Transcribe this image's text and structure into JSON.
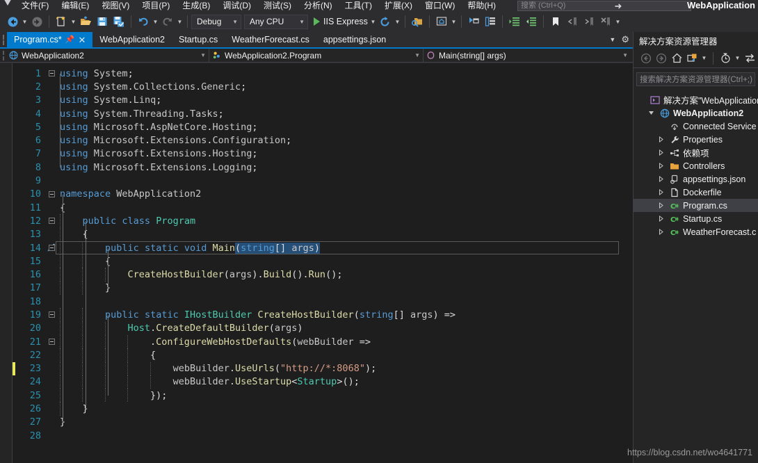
{
  "window": {
    "title": "WebApplication",
    "logo_icon": "visual-studio-logo"
  },
  "menu": {
    "items": [
      {
        "label": "文件(F)"
      },
      {
        "label": "编辑(E)"
      },
      {
        "label": "视图(V)"
      },
      {
        "label": "项目(P)"
      },
      {
        "label": "生成(B)"
      },
      {
        "label": "调试(D)"
      },
      {
        "label": "测试(S)"
      },
      {
        "label": "分析(N)"
      },
      {
        "label": "工具(T)"
      },
      {
        "label": "扩展(X)"
      },
      {
        "label": "窗口(W)"
      },
      {
        "label": "帮助(H)"
      }
    ],
    "search_placeholder": "搜索 (Ctrl+Q)"
  },
  "toolbar": {
    "back_icon": "navigate-back-icon",
    "forward_icon": "navigate-forward-icon",
    "new_item_icon": "new-item-icon",
    "open_file_icon": "open-file-icon",
    "save_icon": "save-icon",
    "save_all_icon": "save-all-icon",
    "undo_icon": "undo-icon",
    "redo_icon": "redo-icon",
    "configuration": "Debug",
    "platform": "Any CPU",
    "run_target": "IIS Express",
    "run_icon": "play-icon",
    "refresh_icon": "refresh-icon",
    "find_in_folder_icon": "find-in-folder-icon",
    "preview_icon": "preview-selected-items-icon",
    "properties_icon": "properties-window-icon",
    "object_browser_icon": "object-browser-icon",
    "indent_icon": "increase-indent-icon",
    "outdent_icon": "decrease-indent-icon",
    "bookmark_icon": "bookmark-icon",
    "prev_bookmark_icon": "previous-bookmark-icon",
    "next_bookmark_icon": "next-bookmark-icon",
    "clear_bookmark_icon": "clear-bookmarks-icon",
    "overflow_icon": "toolbar-overflow-icon"
  },
  "tabs": {
    "items": [
      {
        "label": "Program.cs*",
        "active": true,
        "dirty": true
      },
      {
        "label": "WebApplication2",
        "active": false
      },
      {
        "label": "Startup.cs",
        "active": false
      },
      {
        "label": "WeatherForecast.cs",
        "active": false
      },
      {
        "label": "appsettings.json",
        "active": false
      }
    ],
    "pin_icon": "pin-icon",
    "close_icon": "close-icon",
    "dropdown_icon": "tab-list-dropdown-icon",
    "settings_icon": "gear-icon"
  },
  "navbar": {
    "project": "WebApplication2",
    "project_icon": "web-project-icon",
    "type": "WebApplication2.Program",
    "type_icon": "class-icon",
    "member": "Main(string[] args)",
    "member_icon": "method-icon",
    "caret_icon": "chevron-down-icon"
  },
  "editor": {
    "quick_actions_icon": "quick-actions-screwdriver-icon",
    "quick_actions_line": 14,
    "changed_lines": [
      23
    ],
    "current_line": 14,
    "lines": [
      {
        "n": 1,
        "fold": "minus",
        "tokens": [
          {
            "t": "using ",
            "c": "k"
          },
          {
            "t": "System",
            "c": "ns"
          },
          {
            "t": ";",
            "c": "pn"
          }
        ]
      },
      {
        "n": 2,
        "tokens": [
          {
            "t": "using ",
            "c": "k"
          },
          {
            "t": "System",
            "c": "ns"
          },
          {
            "t": ".",
            "c": "pn"
          },
          {
            "t": "Collections",
            "c": "ns"
          },
          {
            "t": ".",
            "c": "pn"
          },
          {
            "t": "Generic",
            "c": "ns"
          },
          {
            "t": ";",
            "c": "pn"
          }
        ]
      },
      {
        "n": 3,
        "tokens": [
          {
            "t": "using ",
            "c": "k"
          },
          {
            "t": "System",
            "c": "ns"
          },
          {
            "t": ".",
            "c": "pn"
          },
          {
            "t": "Linq",
            "c": "ns"
          },
          {
            "t": ";",
            "c": "pn"
          }
        ]
      },
      {
        "n": 4,
        "tokens": [
          {
            "t": "using ",
            "c": "k"
          },
          {
            "t": "System",
            "c": "ns"
          },
          {
            "t": ".",
            "c": "pn"
          },
          {
            "t": "Threading",
            "c": "ns"
          },
          {
            "t": ".",
            "c": "pn"
          },
          {
            "t": "Tasks",
            "c": "ns"
          },
          {
            "t": ";",
            "c": "pn"
          }
        ]
      },
      {
        "n": 5,
        "tokens": [
          {
            "t": "using ",
            "c": "k"
          },
          {
            "t": "Microsoft",
            "c": "ns"
          },
          {
            "t": ".",
            "c": "pn"
          },
          {
            "t": "AspNetCore",
            "c": "ns"
          },
          {
            "t": ".",
            "c": "pn"
          },
          {
            "t": "Hosting",
            "c": "ns"
          },
          {
            "t": ";",
            "c": "pn"
          }
        ]
      },
      {
        "n": 6,
        "tokens": [
          {
            "t": "using ",
            "c": "k"
          },
          {
            "t": "Microsoft",
            "c": "ns"
          },
          {
            "t": ".",
            "c": "pn"
          },
          {
            "t": "Extensions",
            "c": "ns"
          },
          {
            "t": ".",
            "c": "pn"
          },
          {
            "t": "Configuration",
            "c": "ns"
          },
          {
            "t": ";",
            "c": "pn"
          }
        ]
      },
      {
        "n": 7,
        "tokens": [
          {
            "t": "using ",
            "c": "k"
          },
          {
            "t": "Microsoft",
            "c": "ns"
          },
          {
            "t": ".",
            "c": "pn"
          },
          {
            "t": "Extensions",
            "c": "ns"
          },
          {
            "t": ".",
            "c": "pn"
          },
          {
            "t": "Hosting",
            "c": "ns"
          },
          {
            "t": ";",
            "c": "pn"
          }
        ]
      },
      {
        "n": 8,
        "tokens": [
          {
            "t": "using ",
            "c": "k"
          },
          {
            "t": "Microsoft",
            "c": "ns"
          },
          {
            "t": ".",
            "c": "pn"
          },
          {
            "t": "Extensions",
            "c": "ns"
          },
          {
            "t": ".",
            "c": "pn"
          },
          {
            "t": "Logging",
            "c": "ns"
          },
          {
            "t": ";",
            "c": "pn"
          }
        ]
      },
      {
        "n": 9,
        "tokens": []
      },
      {
        "n": 10,
        "fold": "minus",
        "tokens": [
          {
            "t": "namespace ",
            "c": "k"
          },
          {
            "t": "WebApplication2",
            "c": "ns"
          }
        ]
      },
      {
        "n": 11,
        "tokens": [
          {
            "t": "{",
            "c": "pn"
          }
        ]
      },
      {
        "n": 12,
        "fold": "minus",
        "indent": 1,
        "tokens": [
          {
            "t": "    ",
            "c": "pn"
          },
          {
            "t": "public ",
            "c": "k"
          },
          {
            "t": "class ",
            "c": "k"
          },
          {
            "t": "Program",
            "c": "ty"
          }
        ]
      },
      {
        "n": 13,
        "indent": 1,
        "tokens": [
          {
            "t": "    {",
            "c": "pn"
          }
        ]
      },
      {
        "n": 14,
        "fold": "minus",
        "indent": 2,
        "tokens": [
          {
            "t": "        ",
            "c": "pn"
          },
          {
            "t": "public ",
            "c": "k"
          },
          {
            "t": "static ",
            "c": "k"
          },
          {
            "t": "void ",
            "c": "k"
          },
          {
            "t": "Main",
            "c": "fn"
          },
          {
            "t": "(",
            "c": "pn sel"
          },
          {
            "t": "string",
            "c": "k sel"
          },
          {
            "t": "[] ",
            "c": "pn sel"
          },
          {
            "t": "args",
            "c": "ns sel"
          },
          {
            "t": ")",
            "c": "pn sel"
          }
        ]
      },
      {
        "n": 15,
        "indent": 2,
        "tokens": [
          {
            "t": "        {",
            "c": "pn"
          }
        ]
      },
      {
        "n": 16,
        "indent": 3,
        "tokens": [
          {
            "t": "            ",
            "c": "pn"
          },
          {
            "t": "CreateHostBuilder",
            "c": "fn"
          },
          {
            "t": "(",
            "c": "pn"
          },
          {
            "t": "args",
            "c": "ns"
          },
          {
            "t": ").",
            "c": "pn"
          },
          {
            "t": "Build",
            "c": "fn"
          },
          {
            "t": "().",
            "c": "pn"
          },
          {
            "t": "Run",
            "c": "fn"
          },
          {
            "t": "();",
            "c": "pn"
          }
        ]
      },
      {
        "n": 17,
        "indent": 2,
        "tokens": [
          {
            "t": "        }",
            "c": "pn"
          }
        ]
      },
      {
        "n": 18,
        "tokens": []
      },
      {
        "n": 19,
        "fold": "minus",
        "indent": 2,
        "tokens": [
          {
            "t": "        ",
            "c": "pn"
          },
          {
            "t": "public ",
            "c": "k"
          },
          {
            "t": "static ",
            "c": "k"
          },
          {
            "t": "IHostBuilder ",
            "c": "ty"
          },
          {
            "t": "CreateHostBuilder",
            "c": "fn"
          },
          {
            "t": "(",
            "c": "pn"
          },
          {
            "t": "string",
            "c": "k"
          },
          {
            "t": "[] ",
            "c": "pn"
          },
          {
            "t": "args",
            "c": "ns"
          },
          {
            "t": ") =>",
            "c": "pn"
          }
        ]
      },
      {
        "n": 20,
        "indent": 3,
        "tokens": [
          {
            "t": "            ",
            "c": "pn"
          },
          {
            "t": "Host",
            "c": "ty"
          },
          {
            "t": ".",
            "c": "pn"
          },
          {
            "t": "CreateDefaultBuilder",
            "c": "fn"
          },
          {
            "t": "(",
            "c": "pn"
          },
          {
            "t": "args",
            "c": "ns"
          },
          {
            "t": ")",
            "c": "pn"
          }
        ]
      },
      {
        "n": 21,
        "fold": "minus",
        "indent": 4,
        "tokens": [
          {
            "t": "                .",
            "c": "pn"
          },
          {
            "t": "ConfigureWebHostDefaults",
            "c": "fn"
          },
          {
            "t": "(",
            "c": "pn"
          },
          {
            "t": "webBuilder",
            "c": "ns"
          },
          {
            "t": " =>",
            "c": "pn"
          }
        ]
      },
      {
        "n": 22,
        "indent": 4,
        "tokens": [
          {
            "t": "                {",
            "c": "pn"
          }
        ]
      },
      {
        "n": 23,
        "indent": 5,
        "tokens": [
          {
            "t": "                    ",
            "c": "pn"
          },
          {
            "t": "webBuilder",
            "c": "ns"
          },
          {
            "t": ".",
            "c": "pn"
          },
          {
            "t": "UseUrls",
            "c": "fn"
          },
          {
            "t": "(",
            "c": "pn"
          },
          {
            "t": "\"http://*:8068\"",
            "c": "st"
          },
          {
            "t": ");",
            "c": "pn"
          }
        ]
      },
      {
        "n": 24,
        "indent": 5,
        "tokens": [
          {
            "t": "                    ",
            "c": "pn"
          },
          {
            "t": "webBuilder",
            "c": "ns"
          },
          {
            "t": ".",
            "c": "pn"
          },
          {
            "t": "UseStartup",
            "c": "fn"
          },
          {
            "t": "<",
            "c": "pn"
          },
          {
            "t": "Startup",
            "c": "ty"
          },
          {
            "t": ">();",
            "c": "pn"
          }
        ]
      },
      {
        "n": 25,
        "indent": 4,
        "tokens": [
          {
            "t": "                });",
            "c": "pn"
          }
        ]
      },
      {
        "n": 26,
        "indent": 1,
        "tokens": [
          {
            "t": "    }",
            "c": "pn"
          }
        ]
      },
      {
        "n": 27,
        "tokens": [
          {
            "t": "}",
            "c": "pn"
          }
        ]
      },
      {
        "n": 28,
        "tokens": []
      }
    ],
    "scrollbar": {
      "split_view_icon": "split-view-icon",
      "up_arrow_icon": "scroll-up-icon"
    }
  },
  "solution_explorer": {
    "title": "解决方案资源管理器",
    "toolbar": {
      "back_icon": "back-icon",
      "forward_icon": "forward-icon",
      "home_icon": "home-icon",
      "new_folder_icon": "add-new-folder-icon",
      "pending_changes_icon": "pending-changes-filter-icon",
      "sync_icon": "sync-with-active-document-icon",
      "caret_icon": "chevron-down-icon"
    },
    "search_placeholder": "搜索解决方案资源管理器(Ctrl+;)",
    "tree": [
      {
        "label": "解决方案\"WebApplication",
        "icon": "solution-icon",
        "depth": 0,
        "twisty": "",
        "bold": false
      },
      {
        "label": "WebApplication2",
        "icon": "web-project-icon",
        "depth": 1,
        "twisty": "expanded",
        "bold": true
      },
      {
        "label": "Connected Service",
        "icon": "connected-services-icon",
        "depth": 2,
        "twisty": "",
        "bold": false
      },
      {
        "label": "Properties",
        "icon": "wrench-icon",
        "depth": 2,
        "twisty": "collapsed",
        "bold": false
      },
      {
        "label": "依赖项",
        "icon": "dependencies-icon",
        "depth": 2,
        "twisty": "collapsed",
        "bold": false
      },
      {
        "label": "Controllers",
        "icon": "folder-icon",
        "depth": 2,
        "twisty": "collapsed",
        "bold": false
      },
      {
        "label": "appsettings.json",
        "icon": "json-file-icon",
        "depth": 2,
        "twisty": "collapsed",
        "bold": false
      },
      {
        "label": "Dockerfile",
        "icon": "file-icon",
        "depth": 2,
        "twisty": "collapsed",
        "bold": false
      },
      {
        "label": "Program.cs",
        "icon": "csharp-file-icon",
        "depth": 2,
        "twisty": "collapsed",
        "bold": false,
        "selected": true
      },
      {
        "label": "Startup.cs",
        "icon": "csharp-file-icon",
        "depth": 2,
        "twisty": "collapsed",
        "bold": false
      },
      {
        "label": "WeatherForecast.c",
        "icon": "csharp-file-icon",
        "depth": 2,
        "twisty": "collapsed",
        "bold": false
      }
    ]
  },
  "watermark": "https://blog.csdn.net/wo4641771",
  "colors": {
    "accent": "#007acc",
    "editor_bg": "#1e1e1e",
    "chrome_bg": "#2d2d30",
    "panel_bg": "#252526",
    "keyword": "#569cd6",
    "type": "#4ec9b0",
    "method": "#dcdcaa",
    "string": "#d69d85",
    "linenumber": "#2b91af",
    "selection": "#264f78",
    "change_marker": "#e8e85c"
  }
}
